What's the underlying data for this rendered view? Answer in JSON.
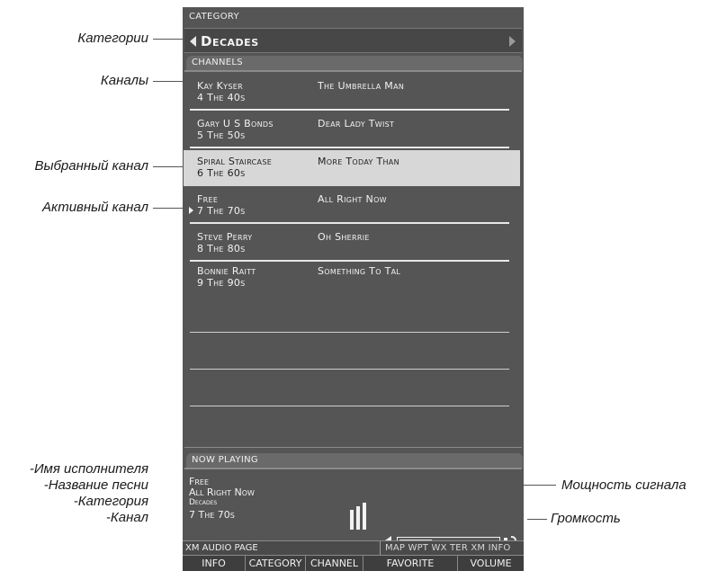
{
  "callouts": {
    "categories": "Категории",
    "channels": "Каналы",
    "selected_channel": "Выбранный канал",
    "active_channel": "Активный канал",
    "artist_name": "-Имя исполнителя",
    "song_title": "-Название песни",
    "category": "-Категория",
    "channel": "-Канал",
    "signal_strength": "Мощность сигнала",
    "volume": "Громкость"
  },
  "category": {
    "header": "CATEGORY",
    "value": "Decades"
  },
  "channels": {
    "header": "CHANNELS",
    "rows": [
      {
        "artist": "Kay Kyser",
        "number": "4   The 40s",
        "song": "The Umbrella Man"
      },
      {
        "artist": "Gary U S Bonds",
        "number": "5   The 50s",
        "song": "Dear Lady Twist"
      },
      {
        "artist": "Spiral Staircase",
        "number": "6   The 60s",
        "song": "More Today Than"
      },
      {
        "artist": "Free",
        "number": "7   The 70s",
        "song": "All Right Now"
      },
      {
        "artist": "Steve Perry",
        "number": "8   The 80s",
        "song": "Oh Sherrie"
      },
      {
        "artist": "Bonnie Raitt",
        "number": "9   The 90s",
        "song": "Something To Tal"
      }
    ]
  },
  "now_playing": {
    "header": "NOW PLAYING",
    "artist": "Free",
    "song": "All Right Now",
    "category": "Decades",
    "channel": "7 The 70s"
  },
  "signal": {
    "bars": 3
  },
  "volume": {
    "level": 0.33
  },
  "page": {
    "title": "XM AUDIO PAGE",
    "tabs": "MAP WPT WX TER XM INFO"
  },
  "softkeys": [
    "INFO",
    "CATEGORY",
    "CHANNEL",
    "FAVORITE",
    "VOLUME"
  ]
}
